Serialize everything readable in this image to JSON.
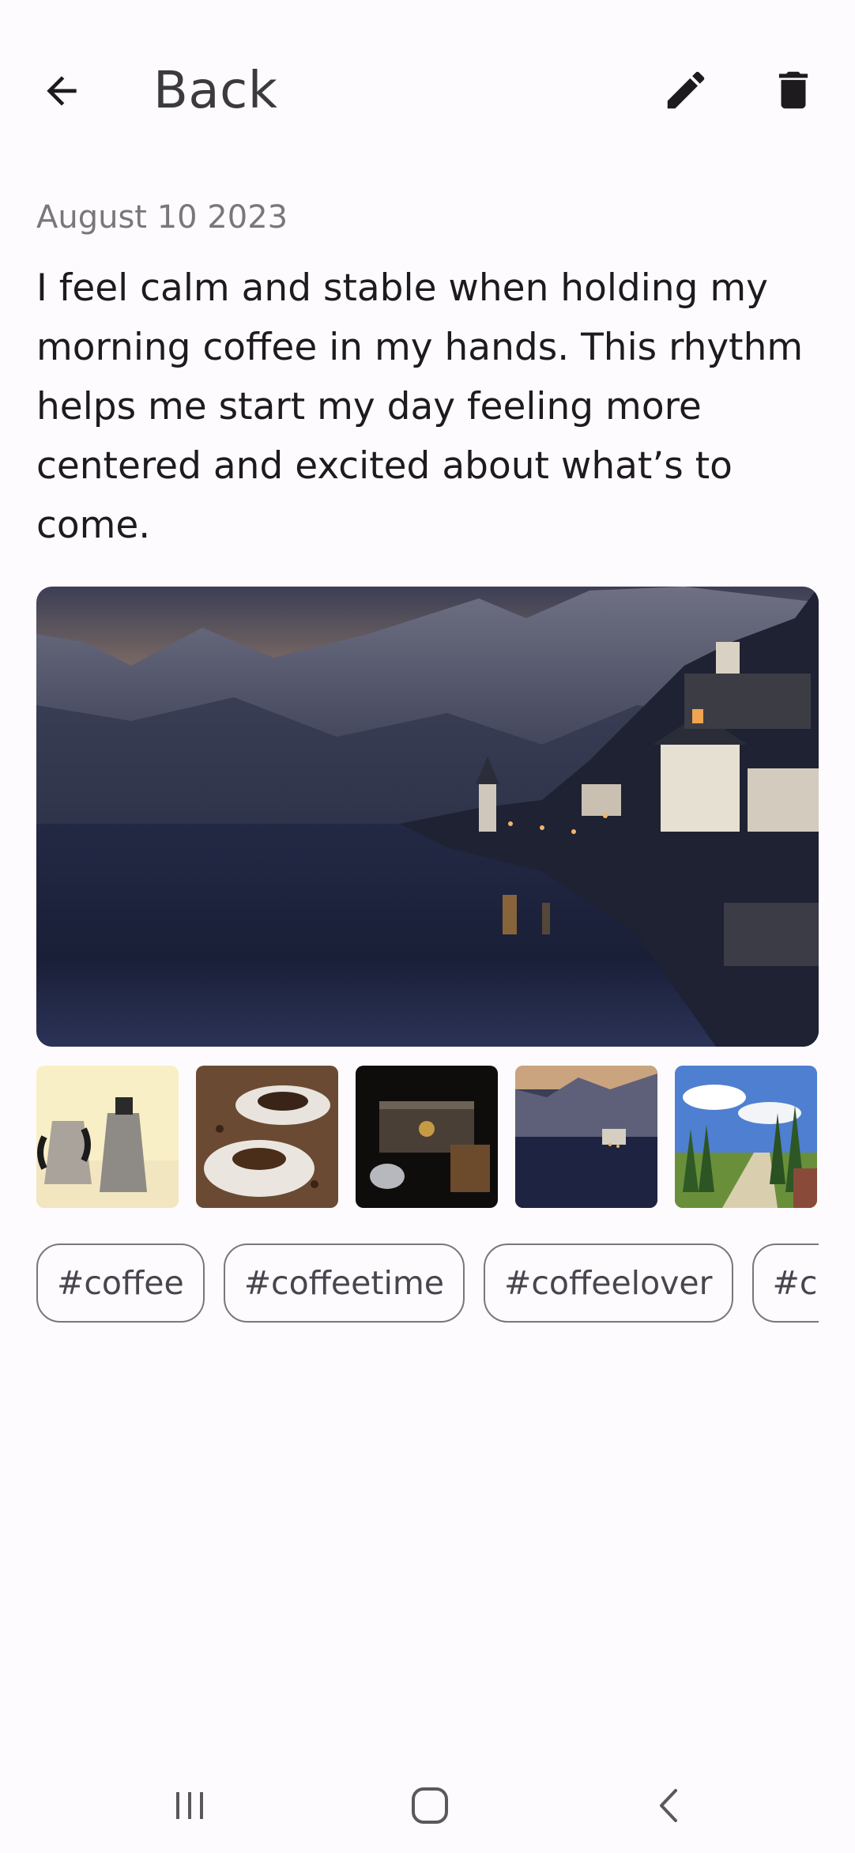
{
  "header": {
    "back_label": "Back",
    "icons": {
      "back": "arrow-back-icon",
      "edit": "pencil-icon",
      "delete": "trash-icon"
    }
  },
  "entry": {
    "date": "August 10 2023",
    "text": "I feel calm and stable when holding my morning coffee in my hands. This rhythm helps me start my day feeling more centered and excited about what’s to come."
  },
  "photos": {
    "main": "Hallstatt lakeside village at dusk",
    "thumbnails": [
      "moka pots",
      "coffee cups with beans",
      "vintage coffee grinder",
      "lakeside village",
      "tree-lined path"
    ]
  },
  "tags": [
    "#coffee",
    "#coffeetime",
    "#coffeelover",
    "#coffee"
  ],
  "system_nav": {
    "recents": "recents-icon",
    "home": "home-icon",
    "back": "nav-back-icon"
  }
}
